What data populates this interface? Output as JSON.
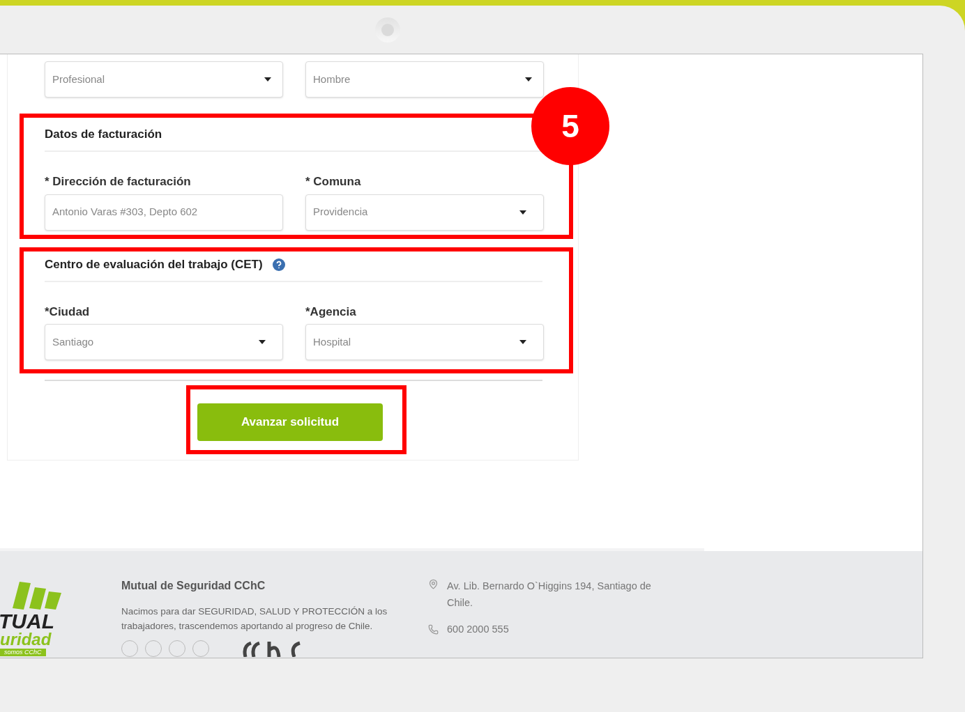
{
  "top_fields": [
    {
      "kind": "select",
      "value": "Profesional"
    },
    {
      "kind": "select",
      "value": "Hombre"
    }
  ],
  "sections": [
    {
      "title": "Datos de facturación",
      "help": false,
      "fields": [
        {
          "label": "* Dirección de facturación",
          "kind": "text",
          "value": "Antonio Varas #303, Depto 602"
        },
        {
          "label": "* Comuna",
          "kind": "select",
          "value": "Providencia"
        }
      ]
    },
    {
      "title": "Centro de evaluación del trabajo (CET)",
      "help": true,
      "fields": [
        {
          "label": "*Ciudad",
          "kind": "select",
          "value": "Santiago"
        },
        {
          "label": "*Agencia",
          "kind": "select",
          "value": "Hospital"
        }
      ]
    }
  ],
  "submit": "Avanzar solicitud",
  "step_badge": "5",
  "footer": {
    "logo": [
      "TUAL",
      "uridad",
      "somos CChC"
    ],
    "org": "Mutual de Seguridad CChC",
    "about": "Nacimos para dar SEGURIDAD, SALUD Y PROTECCIÓN a los trabajadores, trascendemos aportando al progreso de Chile.",
    "address": "Av. Lib. Bernardo O`Higgins 194, Santiago de Chile.",
    "phone": "600 2000 555"
  }
}
